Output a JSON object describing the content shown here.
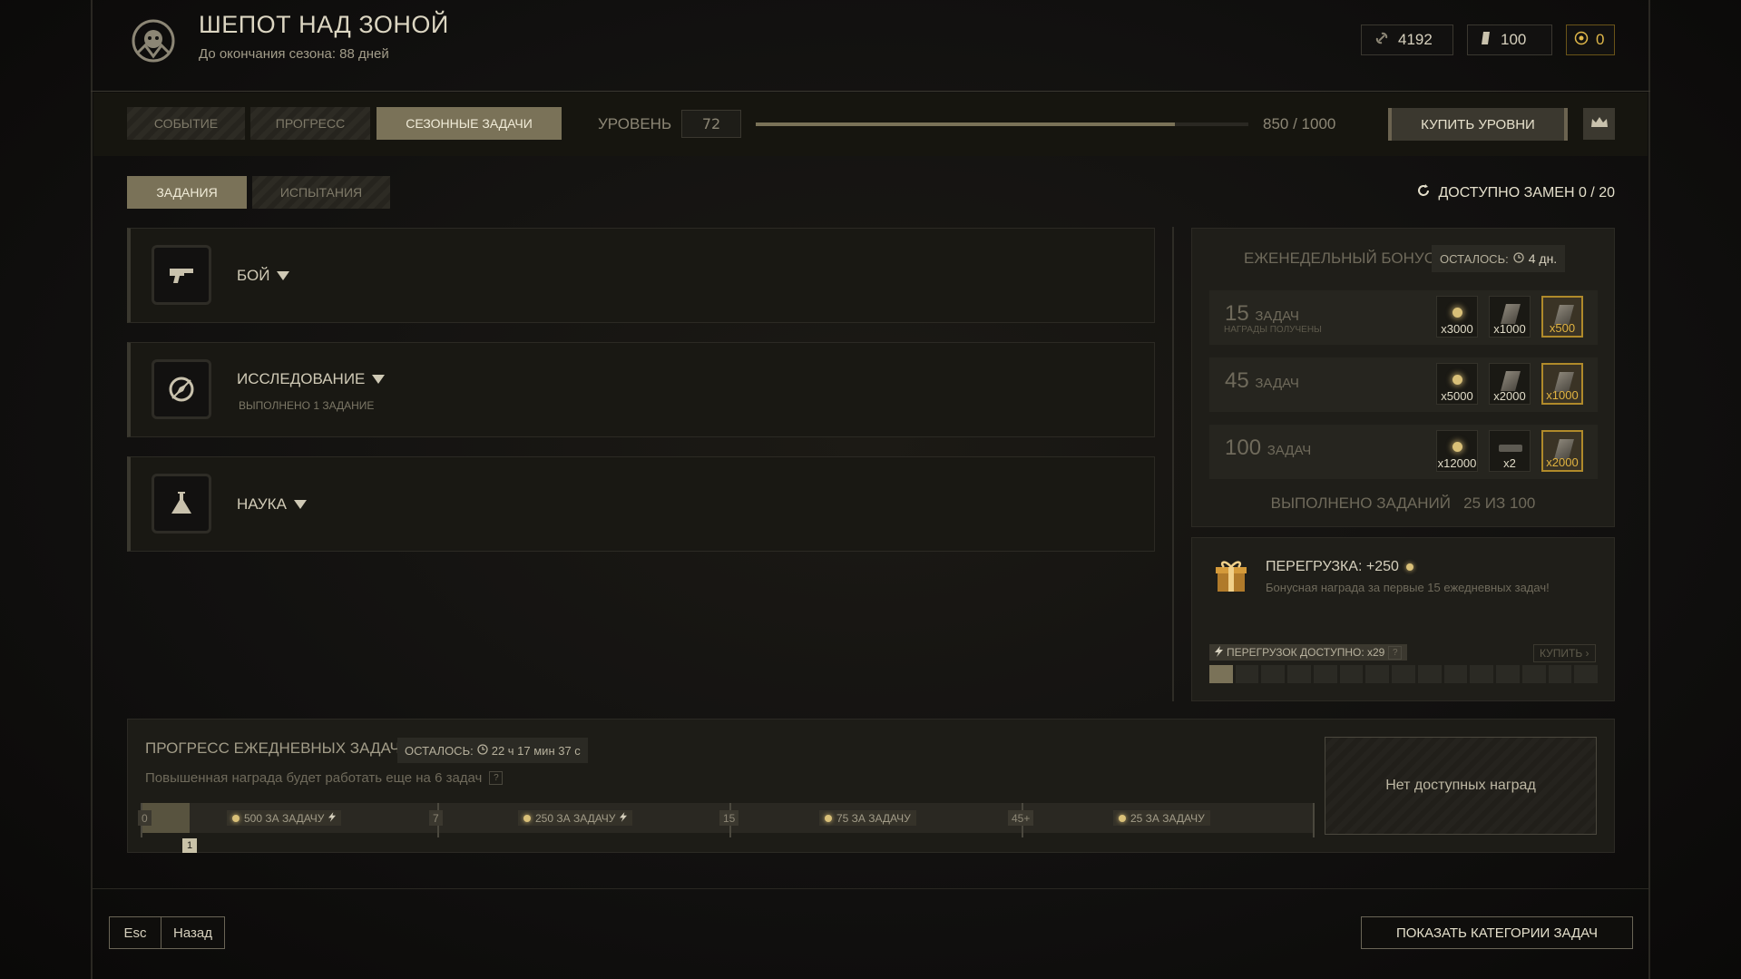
{
  "header": {
    "title": "ШЕПОТ НАД ЗОНОЙ",
    "subtitle": "До окончания сезона: 88 дней",
    "currencies": [
      {
        "icon": "link-icon",
        "value": "4192"
      },
      {
        "icon": "bar-icon",
        "value": "100"
      },
      {
        "icon": "coin-icon",
        "value": "0"
      }
    ]
  },
  "tabs": {
    "event": "СОБЫТИЕ",
    "progress": "ПРОГРЕСС",
    "seasonal": "СЕЗОННЫЕ ЗАДАЧИ"
  },
  "level": {
    "label": "УРОВЕНЬ",
    "value": "72",
    "xp_text": "850 / 1000",
    "xp_fraction": 0.85,
    "buy_label": "КУПИТЬ УРОВНИ"
  },
  "subtabs": {
    "tasks": "ЗАДАНИЯ",
    "trials": "ИСПЫТАНИЯ"
  },
  "swaps": {
    "label": "ДОСТУПНО ЗАМЕН 0 / 20"
  },
  "categories": [
    {
      "name": "БОЙ",
      "icon": "weapon-icon",
      "note": ""
    },
    {
      "name": "ИССЛЕДОВАНИЕ",
      "icon": "compass-icon",
      "note": "ВЫПОЛНЕНО 1 ЗАДАНИЕ"
    },
    {
      "name": "НАУКА",
      "icon": "flask-icon",
      "note": ""
    }
  ],
  "weekly": {
    "title": "ЕЖЕНЕДЕЛЬНЫЙ БОНУС",
    "left_label": "ОСТАЛОСЬ:",
    "left_value": "4 дн.",
    "rows": [
      {
        "count": "15",
        "unit": "ЗАДАЧ",
        "caption": "НАГРАДЫ ПОЛУЧЕНЫ",
        "rewards": [
          "x3000",
          "x1000",
          "x500"
        ]
      },
      {
        "count": "45",
        "unit": "ЗАДАЧ",
        "caption": "",
        "rewards": [
          "x5000",
          "x2000",
          "x1000"
        ]
      },
      {
        "count": "100",
        "unit": "ЗАДАЧ",
        "caption": "",
        "rewards": [
          "x12000",
          "x2",
          "x2000"
        ]
      }
    ],
    "done_label": "ВЫПОЛНЕНО ЗАДАНИЙ",
    "done_value": "25 ИЗ 100"
  },
  "overload": {
    "title": "ПЕРЕГРУЗКА: +250",
    "desc": "Бонусная награда за первые 15 ежедневных задач!",
    "available": "ПЕРЕГРУЗОК ДОСТУПНО: x29",
    "buy": "КУПИТЬ",
    "filled_segments": 1,
    "total_segments": 15
  },
  "daily": {
    "title": "ПРОГРЕСС ЕЖЕДНЕВНЫХ ЗАДАЧ",
    "left_label": "ОСТАЛОСЬ:",
    "left_value": "22 ч 17 мин 37 с",
    "note": "Повышенная награда будет работать еще на 6 задач",
    "marks": [
      "0",
      "7",
      "15",
      "45+"
    ],
    "segments": [
      "500 ЗА ЗАДАЧУ",
      "250 ЗА ЗАДАЧУ",
      "75 ЗА ЗАДАЧУ",
      "25 ЗА ЗАДАЧУ"
    ],
    "current": "1",
    "no_rewards": "Нет доступных наград"
  },
  "footer": {
    "esc_key": "Esc",
    "back": "Назад",
    "show_categories": "ПОКАЗАТЬ КАТЕГОРИИ ЗАДАЧ"
  }
}
